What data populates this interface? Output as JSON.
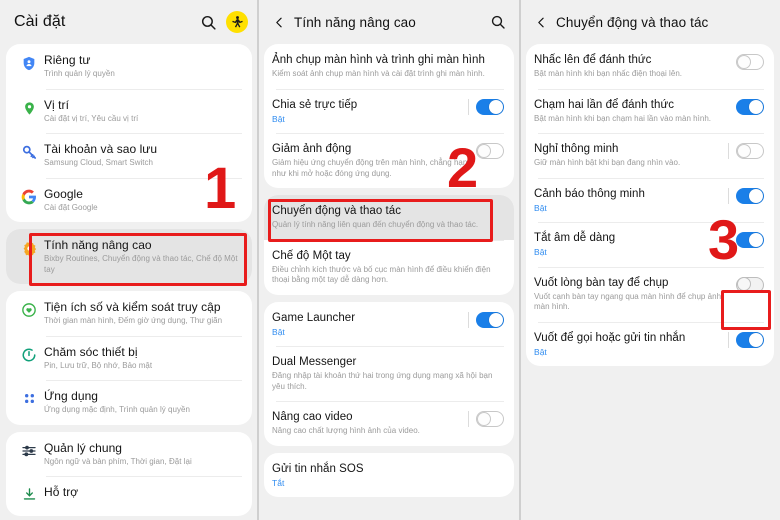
{
  "panels": [
    {
      "id": "settings-root",
      "header": {
        "title": "Cài đặt",
        "back_icon": "",
        "search_icon": "search-icon",
        "bixby_icon": "bixby-routines-icon"
      },
      "groups": [
        {
          "items": [
            {
              "icon": "shield-person-icon",
              "title": "Riêng tư",
              "sub": "Trình quản lý quyền",
              "selected": false
            },
            {
              "icon": "location-pin-icon",
              "title": "Vị trí",
              "sub": "Cài đặt vị trí, Yêu cầu vị trí",
              "selected": false
            },
            {
              "icon": "key-icon",
              "title": "Tài khoản và sao lưu",
              "sub": "Samsung Cloud, Smart Switch",
              "selected": false
            },
            {
              "icon": "google-g-icon",
              "title": "Google",
              "sub": "Cài đặt Google",
              "selected": false
            }
          ]
        },
        {
          "items": [
            {
              "icon": "advanced-gear-icon",
              "title": "Tính năng nâng cao",
              "sub": "Bixby Routines, Chuyển động và thao tác, Chế độ Một tay",
              "selected": true
            }
          ]
        },
        {
          "items": [
            {
              "icon": "wellbeing-heart-icon",
              "title": "Tiện ích số và kiểm soát truy cập",
              "sub": "Thời gian màn hình, Đếm giờ ứng dụng, Thư giãn",
              "selected": false
            },
            {
              "icon": "device-care-icon",
              "title": "Chăm sóc thiết bị",
              "sub": "Pin, Lưu trữ, Bộ nhớ, Bảo mật",
              "selected": false
            },
            {
              "icon": "apps-grid-icon",
              "title": "Ứng dụng",
              "sub": "Ứng dụng mặc định, Trình quản lý quyền",
              "selected": false
            }
          ]
        },
        {
          "items": [
            {
              "icon": "sliders-icon",
              "title": "Quản lý chung",
              "sub": "Ngôn ngữ và bàn phím, Thời gian, Đặt lại",
              "selected": false
            },
            {
              "icon": "support-download-icon",
              "title": "Hỗ trợ",
              "sub": "",
              "selected": false
            }
          ]
        }
      ]
    },
    {
      "id": "advanced-features",
      "header": {
        "title": "Tính năng nâng cao",
        "back_icon": "chevron-left-icon",
        "search_icon": "search-icon"
      },
      "groups": [
        {
          "items": [
            {
              "title": "Ảnh chụp màn hình và trình ghi màn hình",
              "sub": "Kiểm soát ảnh chụp màn hình và cài đặt trình ghi màn hình.",
              "toggle": null,
              "selected": false
            },
            {
              "title": "Chia sẻ trực tiếp",
              "sub": "Bật",
              "sub_style": "on",
              "toggle": "on",
              "selected": false
            },
            {
              "title": "Giảm ảnh động",
              "sub": "Giảm hiệu ứng chuyển động trên màn hình, chẳng hạn như khi mở hoặc đóng ứng dụng.",
              "toggle": "off",
              "selected": false
            }
          ]
        },
        {
          "items": [
            {
              "title": "Chuyển động và thao tác",
              "sub": "Quản lý tính năng liên quan đến chuyển động và thao tác.",
              "toggle": null,
              "selected": true
            },
            {
              "title": "Chế độ Một tay",
              "sub": "Điều chỉnh kích thước và bố cục màn hình để điều khiển điện thoại bằng một tay dễ dàng hơn.",
              "toggle": null,
              "selected": false
            }
          ]
        },
        {
          "items": [
            {
              "title": "Game Launcher",
              "sub": "Bật",
              "sub_style": "on",
              "toggle": "on",
              "selected": false
            },
            {
              "title": "Dual Messenger",
              "sub": "Đăng nhập tài khoản thứ hai trong ứng dụng mạng xã hội bạn yêu thích.",
              "toggle": null,
              "selected": false
            },
            {
              "title": "Nâng cao video",
              "sub": "Nâng cao chất lượng hình ảnh của video.",
              "toggle": "off",
              "divider": true,
              "selected": false
            }
          ]
        },
        {
          "items": [
            {
              "title": "Gửi tin nhắn SOS",
              "sub": "Tắt",
              "sub_style": "on",
              "toggle": null,
              "selected": false
            }
          ]
        }
      ]
    },
    {
      "id": "motions-and-gestures",
      "header": {
        "title": "Chuyển động và thao tác",
        "back_icon": "chevron-left-icon"
      },
      "groups": [
        {
          "items": [
            {
              "title": "Nhấc lên để đánh thức",
              "sub": "Bật màn hình khi bạn nhấc điện thoại lên.",
              "toggle": "off",
              "selected": false
            },
            {
              "title": "Chạm hai lần để đánh thức",
              "sub": "Bật màn hình khi bạn chạm hai lần vào màn hình.",
              "toggle": "on",
              "selected": false
            },
            {
              "title": "Nghỉ thông minh",
              "sub": "Giữ màn hình bật khi bạn đang nhìn vào.",
              "toggle": "off",
              "divider": true,
              "selected": false
            },
            {
              "title": "Cảnh báo thông minh",
              "sub": "Bật",
              "sub_style": "on",
              "toggle": "on",
              "divider": true,
              "selected": false
            },
            {
              "title": "Tắt âm dễ dàng",
              "sub": "Bật",
              "sub_style": "on",
              "toggle": "on",
              "selected": false
            },
            {
              "title": "Vuốt lòng bàn tay để chụp",
              "sub": "Vuốt cạnh bàn tay ngang qua màn hình để chụp ảnh màn hình.",
              "toggle": "off-dim",
              "selected": false
            },
            {
              "title": "Vuốt để gọi hoặc gửi tin nhắn",
              "sub": "Bật",
              "sub_style": "on",
              "toggle": "on",
              "divider": true,
              "selected": false
            }
          ]
        }
      ]
    }
  ],
  "annotations": [
    {
      "label": "1",
      "target": "advanced-features-row"
    },
    {
      "label": "2",
      "target": "motions-and-gestures-row"
    },
    {
      "label": "3",
      "target": "palm-swipe-toggle"
    }
  ],
  "colors": {
    "accent_blue": "#1a7fe8",
    "annotation_red": "#e01818",
    "panel_bg": "#f0f0f0",
    "card_bg": "#ffffff",
    "selected_row": "#e4e4e4",
    "bixby_yellow": "#ffe000"
  }
}
